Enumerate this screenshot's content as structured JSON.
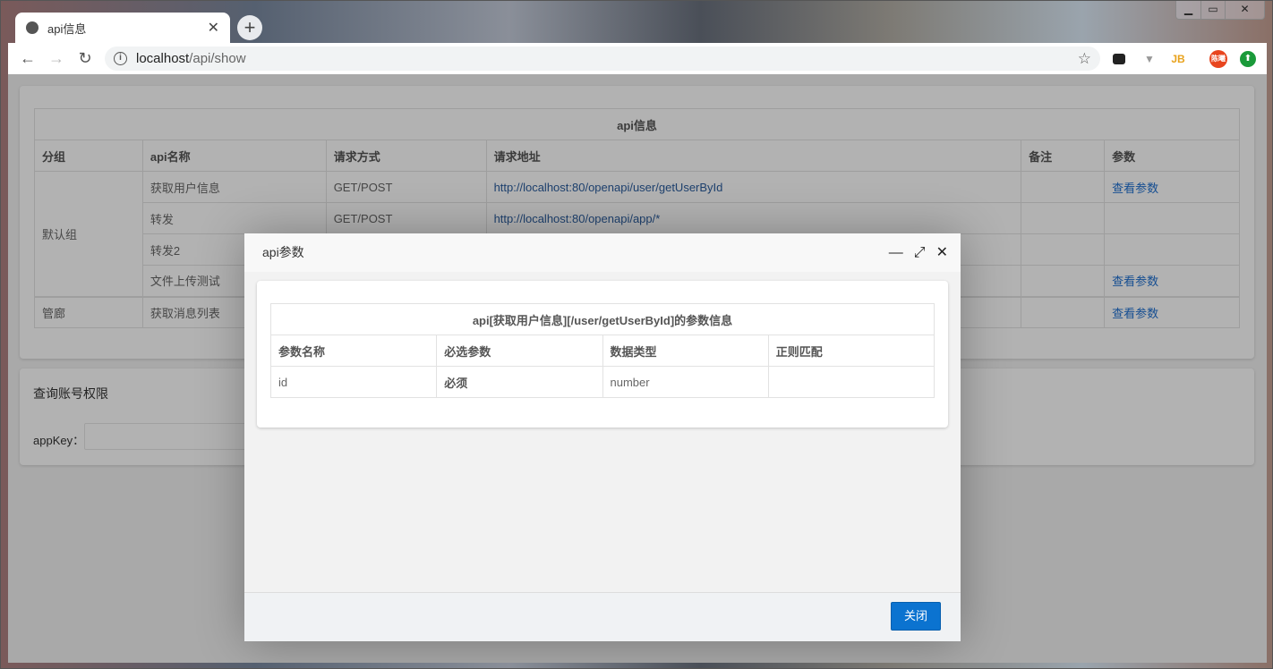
{
  "browser": {
    "tab_title": "api信息",
    "url_host": "localhost",
    "url_path": "/api/show",
    "ext_jb": "JB",
    "profile": "陈曦"
  },
  "api_table": {
    "title": "api信息",
    "headers": [
      "分组",
      "api名称",
      "请求方式",
      "请求地址",
      "备注",
      "参数"
    ],
    "groups": [
      {
        "name": "默认组",
        "rows": [
          {
            "name": "获取用户信息",
            "method": "GET/POST",
            "url": "http://localhost:80/openapi/user/getUserById",
            "param": "查看参数"
          },
          {
            "name": "转发",
            "method": "GET/POST",
            "url": "http://localhost:80/openapi/app/*",
            "param": ""
          },
          {
            "name": "转发2",
            "method": "",
            "url": "",
            "param": ""
          },
          {
            "name": "文件上传测试",
            "method": "",
            "url": "",
            "param": "查看参数"
          }
        ]
      },
      {
        "name": "管廊",
        "rows": [
          {
            "name": "获取消息列表",
            "method": "",
            "url": "",
            "param": "查看参数"
          }
        ]
      }
    ]
  },
  "query": {
    "title": "查询账号权限",
    "appkey_label": "appKey："
  },
  "dialog": {
    "title": "api参数",
    "table_title": "api[获取用户信息][/user/getUserById]的参数信息",
    "headers": [
      "参数名称",
      "必选参数",
      "数据类型",
      "正则匹配"
    ],
    "rows": [
      {
        "name": "id",
        "required": "必须",
        "type": "number",
        "regex": ""
      }
    ],
    "close_label": "关闭"
  }
}
